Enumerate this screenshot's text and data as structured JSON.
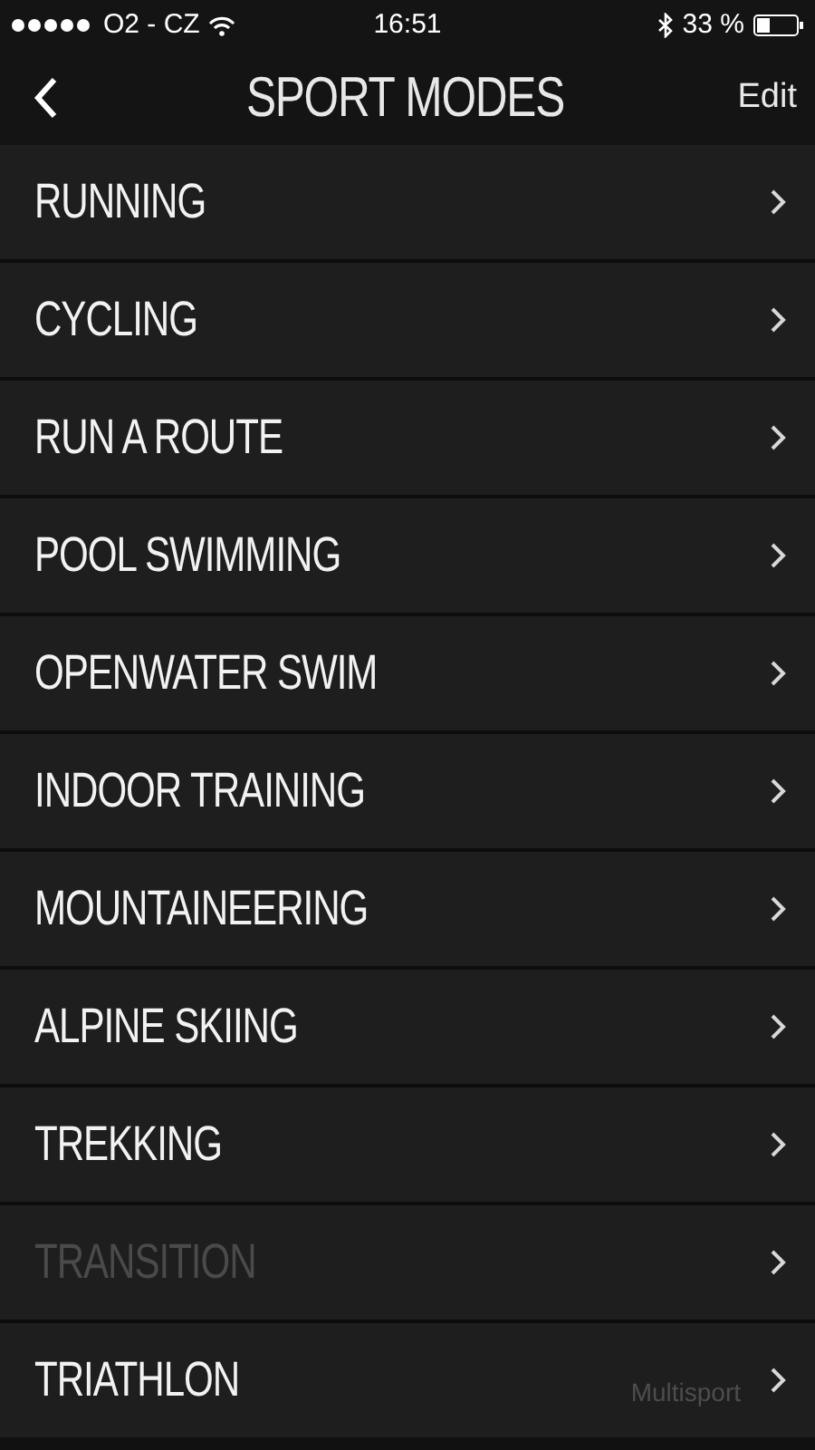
{
  "status_bar": {
    "carrier": "O2 - CZ",
    "time": "16:51",
    "battery": "33 %"
  },
  "nav": {
    "title": "SPORT MODES",
    "action": "Edit"
  },
  "modes": [
    {
      "label": "RUNNING",
      "disabled": false
    },
    {
      "label": "CYCLING",
      "disabled": false
    },
    {
      "label": "RUN A ROUTE",
      "disabled": false
    },
    {
      "label": "POOL SWIMMING",
      "disabled": false
    },
    {
      "label": "OPENWATER SWIM",
      "disabled": false
    },
    {
      "label": "INDOOR TRAINING",
      "disabled": false
    },
    {
      "label": "MOUNTAINEERING",
      "disabled": false
    },
    {
      "label": "ALPINE SKIING",
      "disabled": false
    },
    {
      "label": "TREKKING",
      "disabled": false
    },
    {
      "label": "TRANSITION",
      "disabled": true
    },
    {
      "label": "TRIATHLON",
      "disabled": false,
      "detail": "Multisport"
    }
  ]
}
